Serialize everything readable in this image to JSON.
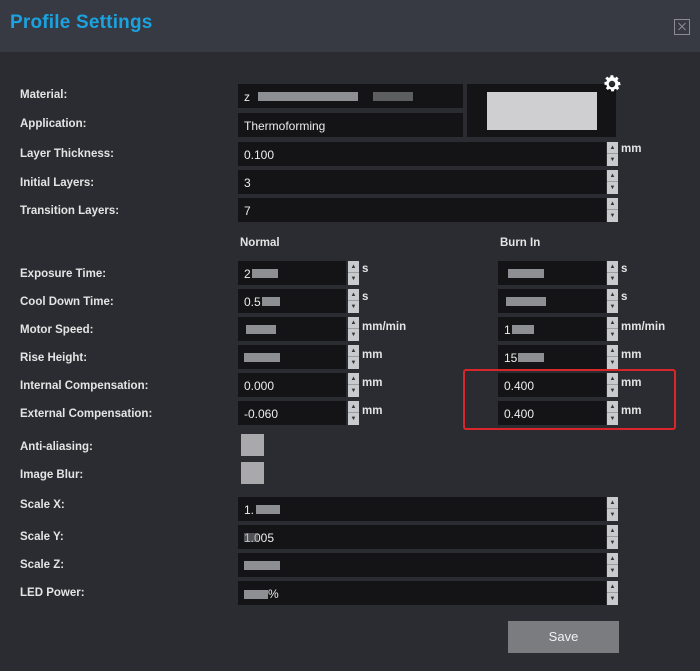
{
  "title": "Profile Settings",
  "labels": {
    "material": "Material:",
    "application": "Application:",
    "layer_thickness": "Layer Thickness:",
    "initial_layers": "Initial Layers:",
    "transition_layers": "Transition Layers:",
    "exposure_time": "Exposure Time:",
    "cool_down_time": "Cool Down Time:",
    "motor_speed": "Motor Speed:",
    "rise_height": "Rise Height:",
    "internal_comp": "Internal Compensation:",
    "external_comp": "External Compensation:",
    "anti_aliasing": "Anti-aliasing:",
    "image_blur": "Image Blur:",
    "scale_x": "Scale X:",
    "scale_y": "Scale Y:",
    "scale_z": "Scale Z:",
    "led_power": "LED Power:"
  },
  "columns": {
    "normal": "Normal",
    "burn_in": "Burn In"
  },
  "values": {
    "material": "z",
    "application": "Thermoforming",
    "layer_thickness": "0.100",
    "initial_layers": "3",
    "transition_layers": "7",
    "exposure_time_normal": "2",
    "exposure_time_burn": "",
    "cool_down_normal": "0.5",
    "cool_down_burn": "",
    "motor_speed_normal": "",
    "motor_speed_burn": "1",
    "rise_height_normal": "",
    "rise_height_burn": "15",
    "internal_comp_normal": "0.000",
    "internal_comp_burn": "0.400",
    "external_comp_normal": "-0.060",
    "external_comp_burn": "0.400",
    "scale_x": "1.",
    "scale_y": "1.005",
    "scale_z": "",
    "led_power": "%"
  },
  "units": {
    "mm": "mm",
    "s": "s",
    "mm_min": "mm/min"
  },
  "icons": {
    "settings": "gear-icon",
    "close": "close-icon"
  },
  "save_label": "Save"
}
